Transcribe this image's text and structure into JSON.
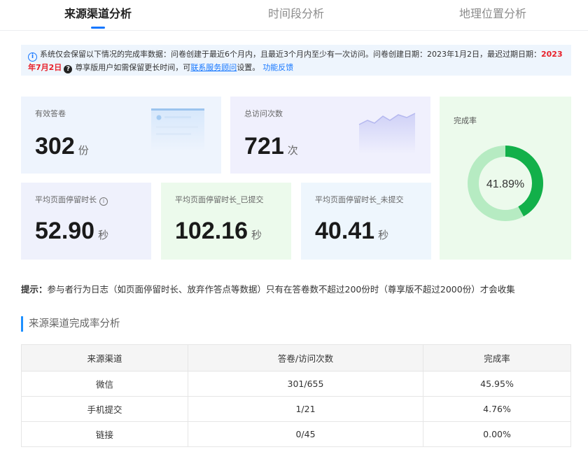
{
  "tabs": [
    {
      "label": "来源渠道分析",
      "active": true
    },
    {
      "label": "时间段分析",
      "active": false
    },
    {
      "label": "地理位置分析",
      "active": false
    }
  ],
  "notice": {
    "icon": "info-icon",
    "text1": "系统仅会保留以下情况的完成率数据：问卷创建于最近6个月内，且最近3个月内至少有一次访问。问卷创建日期：2023年1月2日，最迟过期日期：",
    "expire_date": "2023年7月2日",
    "text2": "尊享版用户如需保留更长时间，可",
    "contact_link": "联系服务顾问",
    "text3": "设置。",
    "feedback_link": "功能反馈"
  },
  "cards": {
    "valid": {
      "label": "有效答卷",
      "value": "302",
      "unit": "份"
    },
    "visits": {
      "label": "总访问次数",
      "value": "721",
      "unit": "次"
    },
    "avg_time": {
      "label": "平均页面停留时长",
      "value": "52.90",
      "unit": "秒"
    },
    "avg_submitted": {
      "label": "平均页面停留时长_已提交",
      "value": "102.16",
      "unit": "秒"
    },
    "avg_unsubmitted": {
      "label": "平均页面停留时长_未提交",
      "value": "40.41",
      "unit": "秒"
    },
    "completion": {
      "label": "完成率",
      "value_text": "41.89%",
      "value": 41.89
    }
  },
  "colors": {
    "donut_main": "#12b04a",
    "donut_rest": "#b6ebc2",
    "accent": "#1677ff"
  },
  "tip": {
    "prefix": "提示：",
    "text": "参与者行为日志（如页面停留时长、放弃作答点等数据）只有在答卷数不超过200份时（尊享版不超过2000份）才会收集"
  },
  "section_title": "来源渠道完成率分析",
  "table": {
    "headers": [
      "来源渠道",
      "答卷/访问次数",
      "完成率"
    ],
    "rows": [
      [
        "微信",
        "301/655",
        "45.95%"
      ],
      [
        "手机提交",
        "1/21",
        "4.76%"
      ],
      [
        "链接",
        "0/45",
        "0.00%"
      ]
    ]
  }
}
